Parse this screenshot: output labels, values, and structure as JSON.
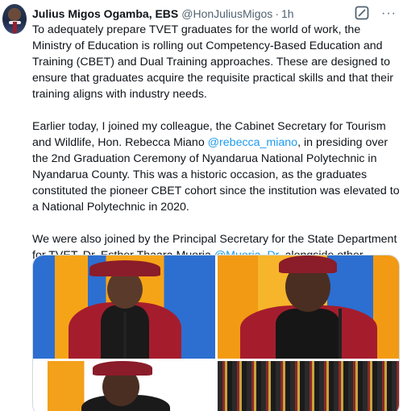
{
  "author": {
    "name": "Julius Migos Ogamba, EBS",
    "handle": "@HonJuliusMigos",
    "separator": "·",
    "time": "1h"
  },
  "icons": {
    "grok": "grok-icon",
    "more": "more-icon",
    "avatar": "avatar"
  },
  "paragraphs": {
    "p1": "To adequately prepare TVET graduates for the world of work, the Ministry of Education is rolling out Competency-Based Education and Training (CBET) and Dual Training approaches. These are designed to ensure that graduates acquire the requisite practical skills and that their training aligns with industry needs.",
    "p2_a": "Earlier today, I joined my colleague, the Cabinet Secretary for Tourism and Wildlife, Hon. Rebecca Miano ",
    "p2_mention": "@rebecca_miano",
    "p2_b": ", in presiding over the 2nd Graduation Ceremony of Nyandarua National Polytechnic in Nyandarua County. This was a historic occasion, as the graduates constituted the pioneer CBET cohort since the institution was elevated to a National Polytechnic in 2020.",
    "p3_a": "We were also joined by the Principal Secretary for the State Department for TVET, Dr. Esther Thaara Muoria ",
    "p3_mention": "@Muoria_Dr",
    "p3_b": ", alongside other leaders and stakeholders."
  },
  "colors": {
    "mention": "#1d9bf0",
    "text": "#0f1419",
    "secondary": "#536471"
  }
}
